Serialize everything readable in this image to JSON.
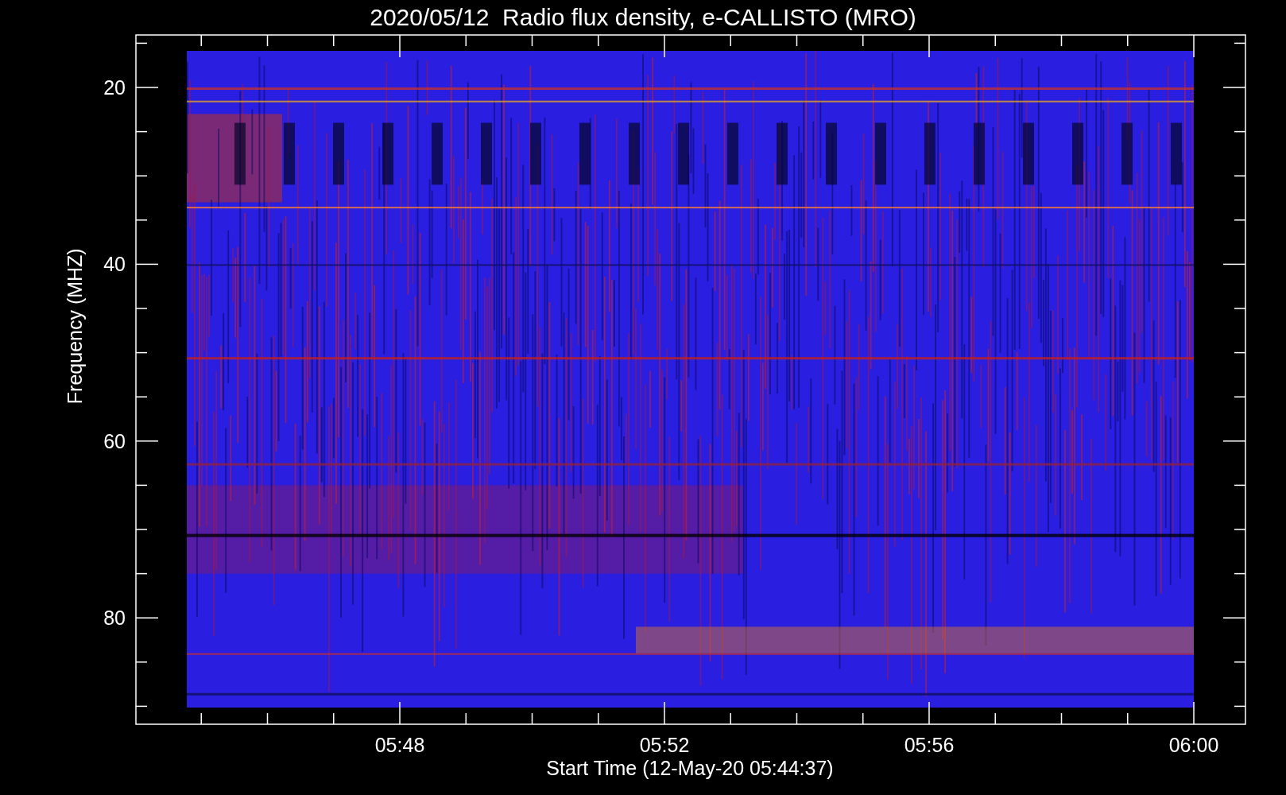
{
  "title": "2020/05/12  Radio flux density, e-CALLISTO (MRO)",
  "y_axis": {
    "label": "Frequency (MHZ)",
    "ticks": [
      "20",
      "40",
      "60",
      "80"
    ]
  },
  "x_axis": {
    "label": "Start Time (12-May-20 05:44:37)",
    "ticks": [
      "05:48",
      "05:52",
      "05:56",
      "06:00"
    ]
  }
}
